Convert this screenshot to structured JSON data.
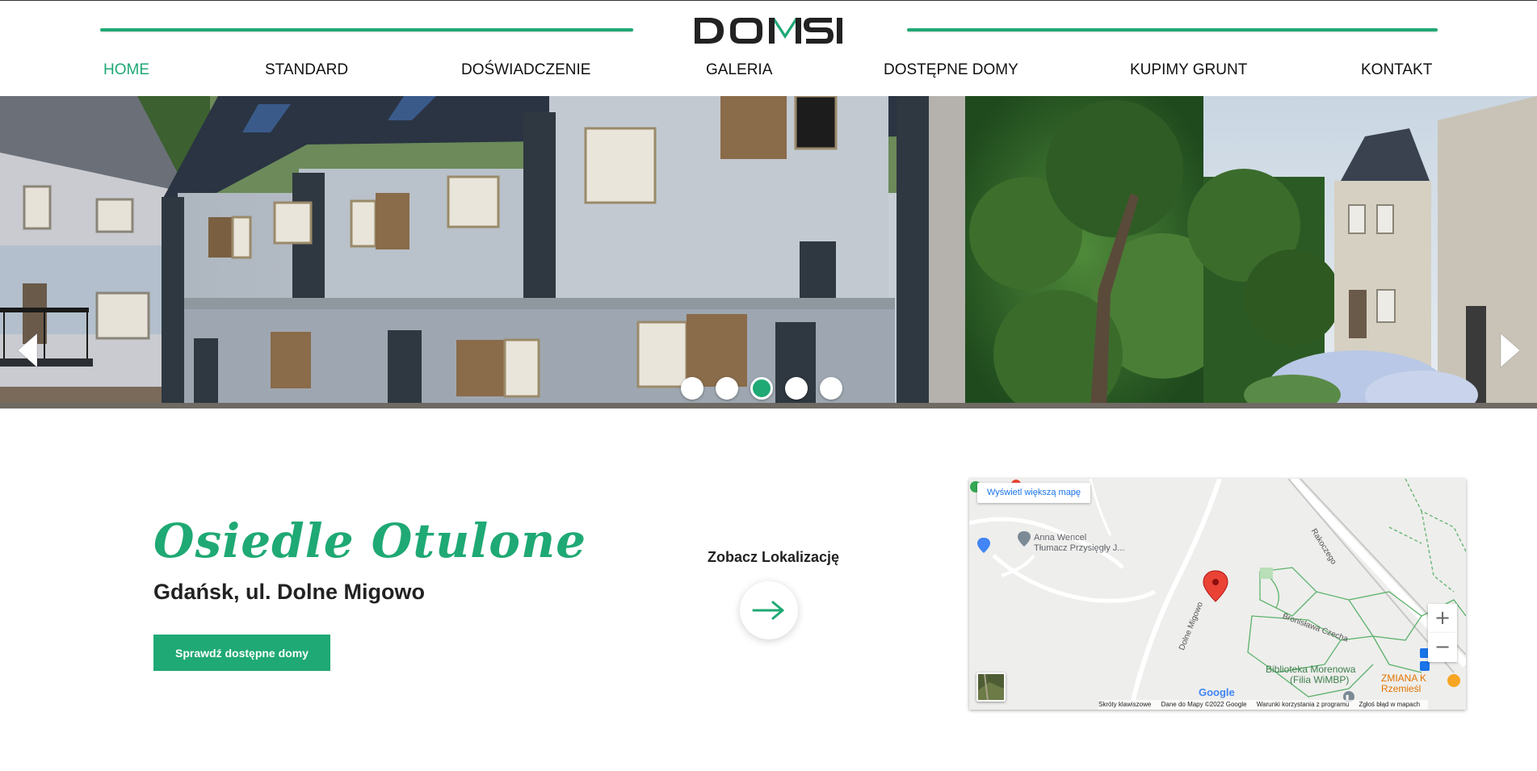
{
  "header": {
    "logo_text": "DOMSI",
    "nav": [
      {
        "label": "HOME",
        "active": true
      },
      {
        "label": "STANDARD",
        "active": false
      },
      {
        "label": "DOŚWIADCZENIE",
        "active": false
      },
      {
        "label": "GALERIA",
        "active": false
      },
      {
        "label": "DOSTĘPNE DOMY",
        "active": false
      },
      {
        "label": "KUPIMY GRUNT",
        "active": false
      },
      {
        "label": "KONTAKT",
        "active": false
      }
    ]
  },
  "slider": {
    "slide_count": 5,
    "active_slide": 3
  },
  "content": {
    "title": "Osiedle Otulone",
    "subtitle": "Gdańsk, ul. Dolne Migowo",
    "cta_label": "Sprawdź dostępne domy",
    "location_label": "Zobacz Lokalizację"
  },
  "map": {
    "larger_map_link": "Wyświetl większą mapę",
    "poi_name_line1": "Anna Wencel",
    "poi_name_line2": "Tłumacz Przysięgły J...",
    "library_line1": "Biblioteka Morenowa",
    "library_line2": "(Filia WiMBP)",
    "orange_poi_line1": "ZMIANA K",
    "orange_poi_line2": "Rzemieśl",
    "streets": [
      "Rakoczego",
      "Bronisława Czecha",
      "Dolne Migowo"
    ],
    "google_logo": "Google",
    "footer": [
      "Skróty klawiszowe",
      "Dane do Mapy ©2022 Google",
      "Warunki korzystania z programu",
      "Zgłoś błąd w mapach"
    ],
    "zoom_in": "+",
    "zoom_out": "−"
  },
  "colors": {
    "brand_green": "#1fa974",
    "text_dark": "#222222",
    "map_bg": "#eeeeec",
    "pin_red": "#ea4335"
  },
  "icons": {
    "prev": "chevron-left-icon",
    "next": "chevron-right-icon",
    "location_arrow": "arrow-right-icon",
    "map_pin": "map-pin-icon"
  }
}
